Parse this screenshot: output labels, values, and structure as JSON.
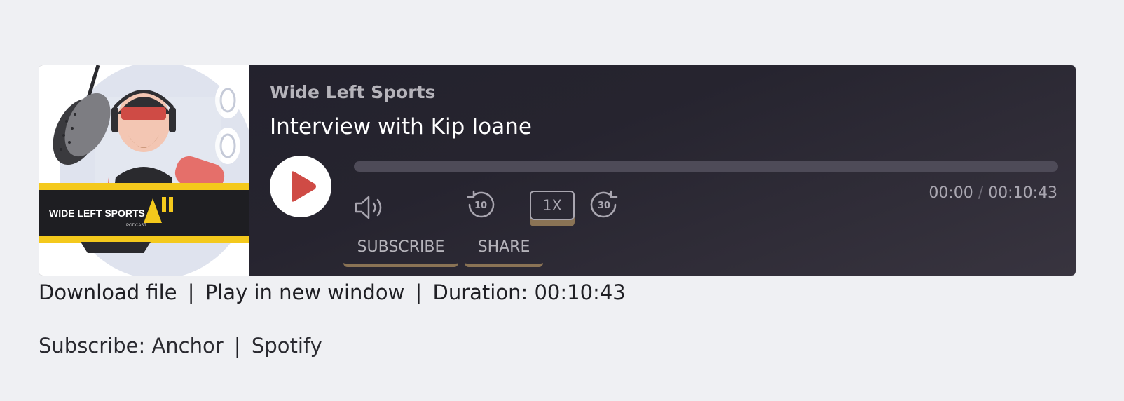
{
  "player": {
    "show_title": "Wide Left Sports",
    "episode_title": "Interview with Kip Ioane",
    "artwork_text": "WIDE LEFT SPORTS",
    "artwork_subtext": "PODCAST",
    "progress_fraction": 0,
    "current_time": "00:00",
    "time_separator": "/",
    "total_time": "00:10:43",
    "rewind_seconds": "10",
    "forward_seconds": "30",
    "speed_label": "1X",
    "subscribe_label": "SUBSCRIBE",
    "share_label": "SHARE",
    "icons": {
      "play": "play-icon",
      "volume": "volume-icon",
      "rewind": "rewind-10-icon",
      "forward": "forward-30-icon"
    },
    "colors": {
      "accent": "#cf4b45",
      "underline": "#8a7355"
    }
  },
  "meta": {
    "download_label": "Download file",
    "separator": "|",
    "new_window_label": "Play in new window",
    "duration_label": "Duration: 00:10:43"
  },
  "subscribe": {
    "prefix": "Subscribe:",
    "anchor_label": "Anchor",
    "separator": "|",
    "spotify_label": "Spotify"
  }
}
